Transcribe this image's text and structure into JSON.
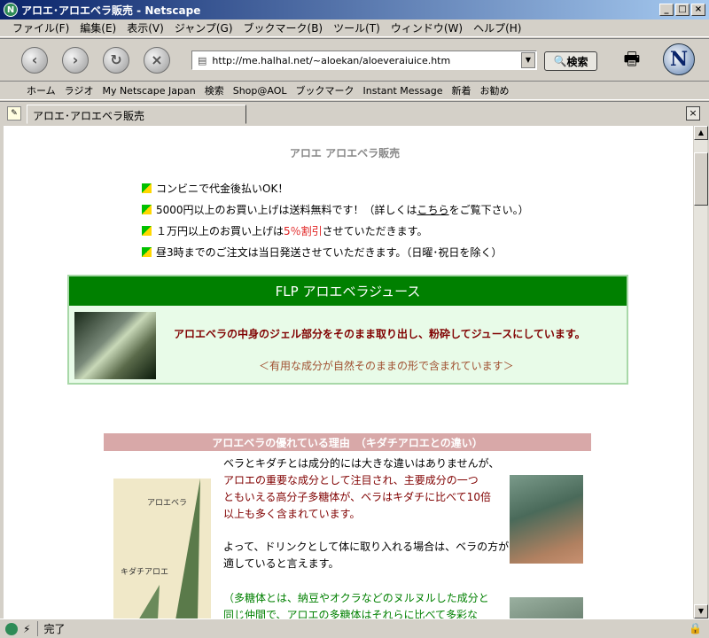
{
  "window": {
    "title": "アロエ･アロエベラ販売 - Netscape"
  },
  "menu": [
    "ファイル(F)",
    "編集(E)",
    "表示(V)",
    "ジャンプ(G)",
    "ブックマーク(B)",
    "ツール(T)",
    "ウィンドウ(W)",
    "ヘルプ(H)"
  ],
  "navbar": {
    "url": "http://me.halhal.net/~aloekan/aloeveraiuice.htm",
    "search_label": "検索"
  },
  "personal_toolbar": [
    "ホーム",
    "ラジオ",
    "My Netscape Japan",
    "検索",
    "Shop@AOL",
    "ブックマーク",
    "Instant Message",
    "新着",
    "お勧め"
  ],
  "tab": {
    "label": "アロエ･アロエベラ販売"
  },
  "page": {
    "title": "アロエ アロエベラ販売",
    "bullets": {
      "b1": "コンビニで代金後払いOK！",
      "b2_pre": "5000円以上のお買い上げは送料無料です！（詳しくは",
      "b2_link": "こちら",
      "b2_post": "をご覧下さい。）",
      "b3_pre": "１万円以上のお買い上げは ",
      "b3_red": "5％割引",
      "b3_post": " させていただきます。",
      "b4": "昼3時までのご注文は当日発送させていただきます。（日曜･祝日を除く）"
    },
    "flp": {
      "header": "FLP アロエベラジュース",
      "text": "アロエベラの中身のジェル部分をそのまま取り出し、粉砕してジュースにしています。",
      "sub": "＜有用な成分が自然そのままの形で含まれています＞"
    },
    "reason": {
      "header": "アロエベラの優れている理由　（キダチアロエとの違い）",
      "img_label_1": "アロエベラ",
      "img_label_2": "キダチアロエ",
      "p1_l1": "ベラとキダチとは成分的には大きな違いはありませんが、",
      "p1_l2": "アロエの重要な成分として注目され、主要成分の一つ",
      "p1_l3": "ともいえる高分子多糖体が、ベラはキダチに比べて10倍",
      "p1_l4": "以上も多く含まれています。",
      "p2_l1": "よって、ドリンクとして体に取り入れる場合は、ベラの方が",
      "p2_l2": "適していると言えます。",
      "p3_l1": "（多糖体とは、納豆やオクラなどのヌルヌルした成分と",
      "p3_l2": "同じ仲間で、アロエの多糖体はそれらに比べて多彩な"
    }
  },
  "status": {
    "text": "完了"
  }
}
